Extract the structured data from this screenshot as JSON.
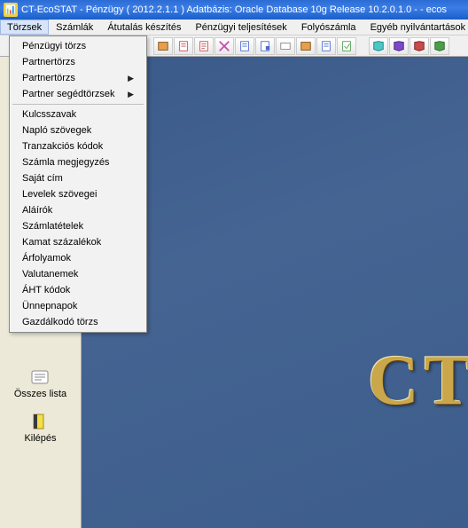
{
  "title": "CT-EcoSTAT - Pénzügy ( 2012.2.1.1 ) Adatbázis: Oracle Database 10g Release 10.2.0.1.0 - - ecos",
  "menubar": {
    "items": [
      "Törzsek",
      "Számlák",
      "Átutalás készítés",
      "Pénzügyi teljesítések",
      "Folyószámla",
      "Egyéb nyilvántartások"
    ]
  },
  "dropdown": {
    "group1": [
      "Pénzügyi törzs",
      "Partnertörzs",
      "Partnertörzs",
      "Partner segédtörzsek"
    ],
    "group2": [
      "Kulcsszavak",
      "Napló szövegek",
      "Tranzakciós kódok",
      "Számla megjegyzés",
      "Saját cím",
      "Levelek szövegei",
      "Aláírók",
      "Számlatételek",
      "Kamat százalékok",
      "Árfolyamok",
      "Valutanemek",
      "ÁHT kódok",
      "Ünnepnapok",
      "Gazdálkodó törzs"
    ]
  },
  "sidebar": {
    "item1": "Összes lista",
    "item2": "Kilépés"
  },
  "brand": "CT",
  "toolbar_icons": [
    "tool-1",
    "tool-2",
    "tool-3",
    "tool-4",
    "tool-5",
    "tool-6",
    "tool-7",
    "tool-8",
    "tool-9",
    "tool-10",
    "tool-11",
    "tool-12",
    "tool-13",
    "tool-14",
    "tool-15"
  ],
  "icon_colors": {
    "c1": "#c74b4b",
    "c2": "#4f9c4f",
    "c3": "#4a6bcf",
    "c4": "#c74bb5",
    "c5": "#c7a24b",
    "c6": "#4bc7c7",
    "c7": "#7a4bc7"
  }
}
